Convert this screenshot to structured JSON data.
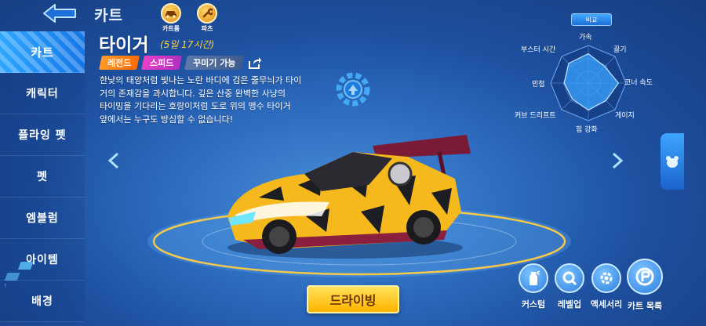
{
  "header": {
    "title": "카트",
    "tabs": [
      {
        "label": "카트룸",
        "icon": "car-icon"
      },
      {
        "label": "파츠",
        "icon": "wrench-icon"
      }
    ]
  },
  "sidebar": {
    "items": [
      {
        "label": "카트",
        "active": true
      },
      {
        "label": "캐릭터"
      },
      {
        "label": "플라잉 펫"
      },
      {
        "label": "펫"
      },
      {
        "label": "엠블럼"
      },
      {
        "label": "아이템"
      },
      {
        "label": "배경"
      }
    ]
  },
  "kart": {
    "name": "타이거",
    "time_left": "(5일 17시간)",
    "tags": [
      "레전드",
      "스피드",
      "꾸미기 가능"
    ],
    "description_lines": [
      "한낮의 태양처럼 빛나는 노란 바디에 검은 줄무늬가 타이",
      "거의 존재감을 과시합니다. 깊은 산중 완벽한 사냥의",
      "타이밍을 기다리는 호랑이처럼 도로 위의 맹수 타이거",
      "앞에서는 누구도 방심할 수 없습니다!"
    ]
  },
  "stats": {
    "compare_label": "비교",
    "labels": {
      "accel": "가속",
      "drag": "끌기",
      "corner": "코너 속도",
      "gauge": "게이지",
      "power": "힘 강화",
      "curve_drift": "커브 드리프트",
      "agility": "민첩",
      "boost_time": "부스터 시간"
    },
    "values": {
      "accel": 0.78,
      "drag": 0.62,
      "corner": 0.8,
      "gauge": 0.66,
      "power": 0.72,
      "curve_drift": 0.6,
      "agility": 0.64,
      "boost_time": 0.74
    }
  },
  "actions": {
    "drive_label": "드라이빙",
    "buttons": [
      {
        "label": "커스텀",
        "icon": "spray-icon"
      },
      {
        "label": "레벨업",
        "icon": "magnifier-icon"
      },
      {
        "label": "액세서리",
        "icon": "gear-icon"
      },
      {
        "label": "카트 목록",
        "icon": "kart-list-icon"
      }
    ]
  },
  "colors": {
    "accent_yellow": "#ffb400",
    "legend_tag": "#ff7a10",
    "speed_tag": "#c936c3",
    "active_tab": "#1f8cf2"
  }
}
